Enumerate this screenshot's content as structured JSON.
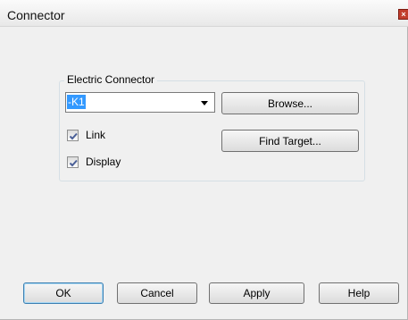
{
  "window": {
    "title": "Connector",
    "close_glyph": "×"
  },
  "group": {
    "label": "Electric Connector"
  },
  "connector_select": {
    "value": "-K1"
  },
  "buttons": {
    "browse": "Browse...",
    "find_target": "Find Target...",
    "ok": "OK",
    "cancel": "Cancel",
    "apply": "Apply",
    "help": "Help"
  },
  "checkboxes": {
    "link": {
      "label": "Link",
      "checked": true
    },
    "display": {
      "label": "Display",
      "checked": true
    }
  },
  "icons": {
    "close": "close-icon",
    "dropdown": "dropdown-arrow-icon",
    "check": "checkmark-icon"
  }
}
